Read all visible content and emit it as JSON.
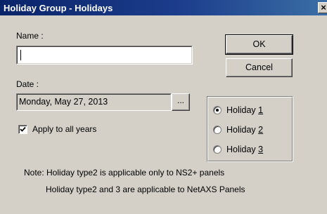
{
  "window": {
    "title": "Holiday Group - Holidays",
    "close_glyph": "×"
  },
  "form": {
    "name_label": "Name :",
    "name_value": "",
    "date_label": "Date :",
    "date_value": "Monday, May 27, 2013",
    "browse_label": "...",
    "apply_all_years_label": "Apply to all years",
    "apply_all_years_checked": true
  },
  "buttons": {
    "ok": "OK",
    "cancel": "Cancel"
  },
  "holiday_type": {
    "selected": "Holiday 1",
    "options": [
      {
        "prefix": "Holiday ",
        "accel": "1"
      },
      {
        "prefix": "Holiday ",
        "accel": "2"
      },
      {
        "prefix": "Holiday ",
        "accel": "3"
      }
    ]
  },
  "notes": {
    "line1": "Note: Holiday type2 is applicable only to NS2+ panels",
    "line2": "Holiday type2 and 3 are applicable to NetAXS Panels"
  },
  "colors": {
    "titlebar": "#0a246a",
    "dialog_background": "#d4d0c8"
  }
}
